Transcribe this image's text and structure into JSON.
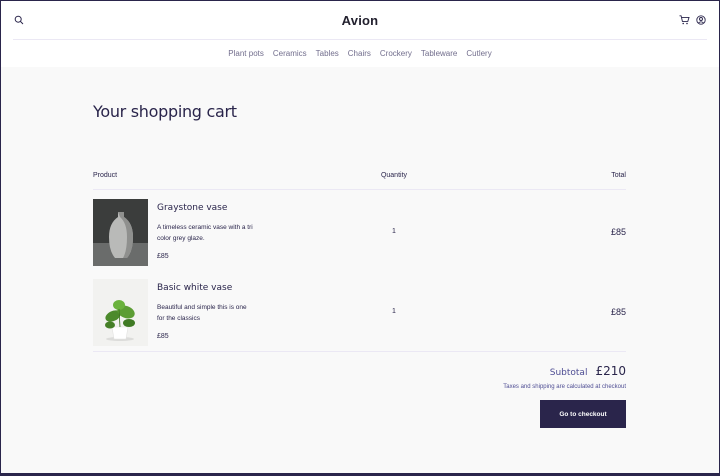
{
  "header": {
    "brand": "Avion"
  },
  "nav": {
    "categories": [
      "Plant pots",
      "Ceramics",
      "Tables",
      "Chairs",
      "Crockery",
      "Tableware",
      "Cutlery"
    ]
  },
  "cart": {
    "title": "Your shopping cart",
    "columns": {
      "product": "Product",
      "quantity": "Quantity",
      "total": "Total"
    },
    "items": [
      {
        "name": "Graystone vase",
        "description": "A timeless ceramic vase with a tri color grey glaze.",
        "price": "£85",
        "quantity": "1",
        "total": "£85"
      },
      {
        "name": "Basic white vase",
        "description": "Beautiful and simple this is one for the classics",
        "price": "£85",
        "quantity": "1",
        "total": "£85"
      }
    ],
    "subtotal_label": "Subtotal",
    "subtotal_value": "£210",
    "tax_note": "Taxes and shipping are calculated at checkout",
    "checkout_label": "Go to checkout"
  },
  "icons": {
    "search": "search-icon",
    "cart": "cart-icon",
    "user": "user-icon"
  },
  "colors": {
    "primary": "#2a254b",
    "muted": "#726e8d",
    "background": "#f9f9f9"
  }
}
